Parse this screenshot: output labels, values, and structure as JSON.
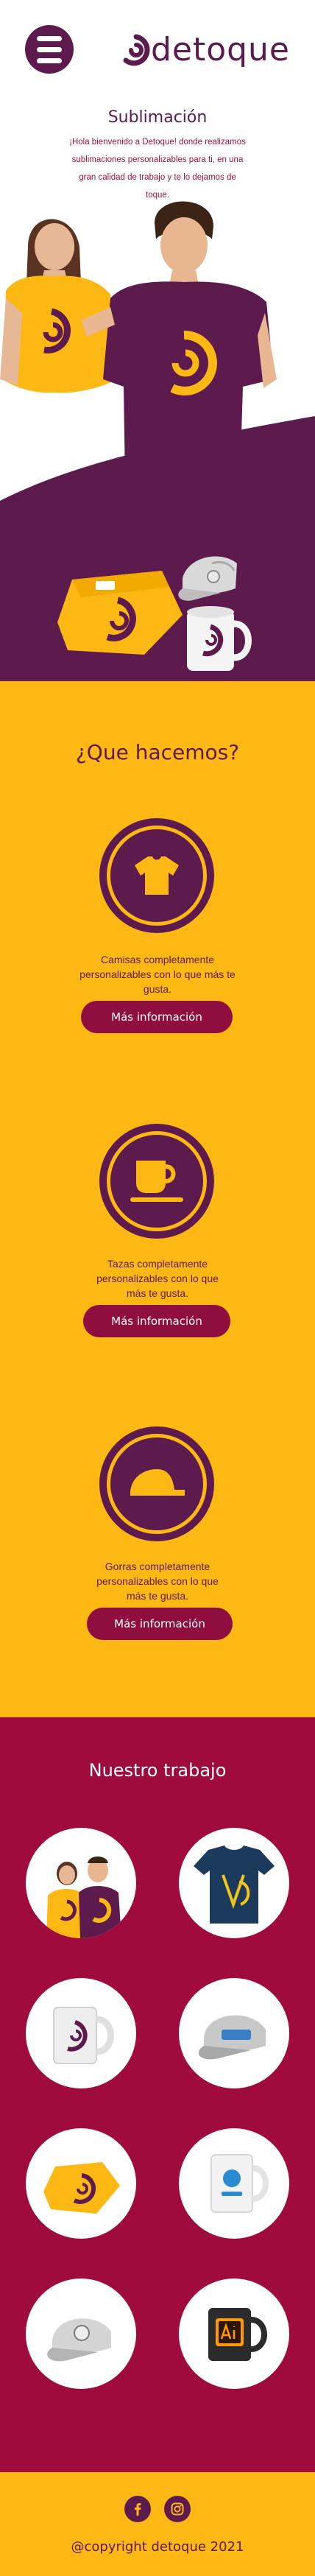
{
  "brand": {
    "name": "detoque",
    "colors": {
      "primary": "#5c1a4d",
      "accent": "#fdb813",
      "crimson": "#9e0b3c",
      "button": "#8e0f3f",
      "text_red": "#a0133a"
    }
  },
  "header": {
    "menu_icon": "hamburger-menu-icon",
    "logo_icon": "d-swirl-logo-icon"
  },
  "hero": {
    "title": "Sublimación",
    "text": "¡Hola bienvenido a Detoque! donde realizamos sublimaciones personalizables para ti, en una gran calidad de trabajo y te lo dejamos de toque."
  },
  "services": {
    "title": "¿Que hacemos?",
    "items": [
      {
        "icon": "tshirt-icon",
        "description": "Camisas completamente personalizables con lo que más te gusta.",
        "button": "Más información"
      },
      {
        "icon": "mug-icon",
        "description": "Tazas completamente personalizables con lo que más te gusta.",
        "button": "Más información"
      },
      {
        "icon": "cap-icon",
        "description": "Gorras completamente personalizables con lo que más te gusta.",
        "button": "Más información"
      }
    ]
  },
  "work": {
    "title": "Nuestro trabajo",
    "items": [
      {
        "name": "models-tshirts-photo"
      },
      {
        "name": "blue-tshirt-photo"
      },
      {
        "name": "white-mug-photo"
      },
      {
        "name": "grey-cap-photo"
      },
      {
        "name": "folded-tshirt-photo"
      },
      {
        "name": "blue-print-mug-photo"
      },
      {
        "name": "logo-cap-photo"
      },
      {
        "name": "ai-logo-mug-photo"
      }
    ]
  },
  "footer": {
    "social": [
      {
        "icon": "facebook-icon"
      },
      {
        "icon": "instagram-icon"
      }
    ],
    "copyright": "@copyright detoque 2021"
  }
}
